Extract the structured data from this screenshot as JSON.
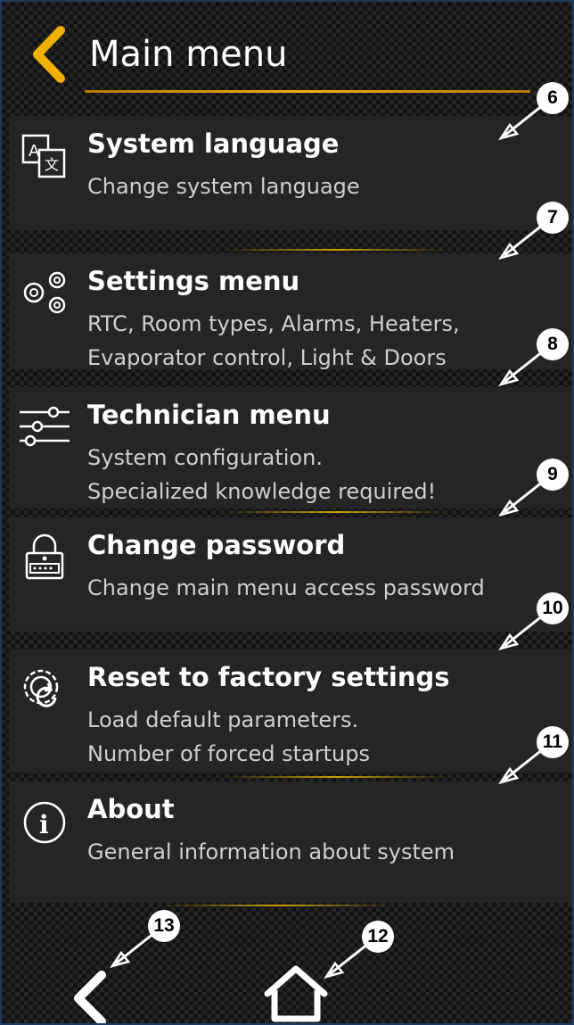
{
  "header": {
    "title": "Main menu"
  },
  "menu": {
    "items": [
      {
        "title": "System language",
        "desc1": "Change system language",
        "desc2": ""
      },
      {
        "title": "Settings menu",
        "desc1": "RTC, Room types, Alarms, Heaters,",
        "desc2": "Evaporator control, Light & Doors"
      },
      {
        "title": "Technician menu",
        "desc1": "System configuration.",
        "desc2": "Specialized knowledge required!"
      },
      {
        "title": "Change password",
        "desc1": "Change main menu access password",
        "desc2": ""
      },
      {
        "title": "Reset to factory settings",
        "desc1": "Load default parameters.",
        "desc2": "Number of forced startups"
      },
      {
        "title": "About",
        "desc1": "General information about system",
        "desc2": ""
      }
    ]
  },
  "callouts": [
    "6",
    "7",
    "8",
    "9",
    "10",
    "11",
    "12",
    "13"
  ],
  "icons": {
    "back": "chevron-left-icon",
    "language": "translate-icon",
    "settings": "gears-icon",
    "technician": "sliders-icon",
    "password": "padlock-icon",
    "reset": "reset-gear-icon",
    "about": "info-icon",
    "home": "home-icon"
  },
  "colors": {
    "accent": "#f0b000",
    "background": "#121212",
    "panel": "#252525",
    "text": "#ffffff",
    "subtext": "#cfcfcf"
  }
}
